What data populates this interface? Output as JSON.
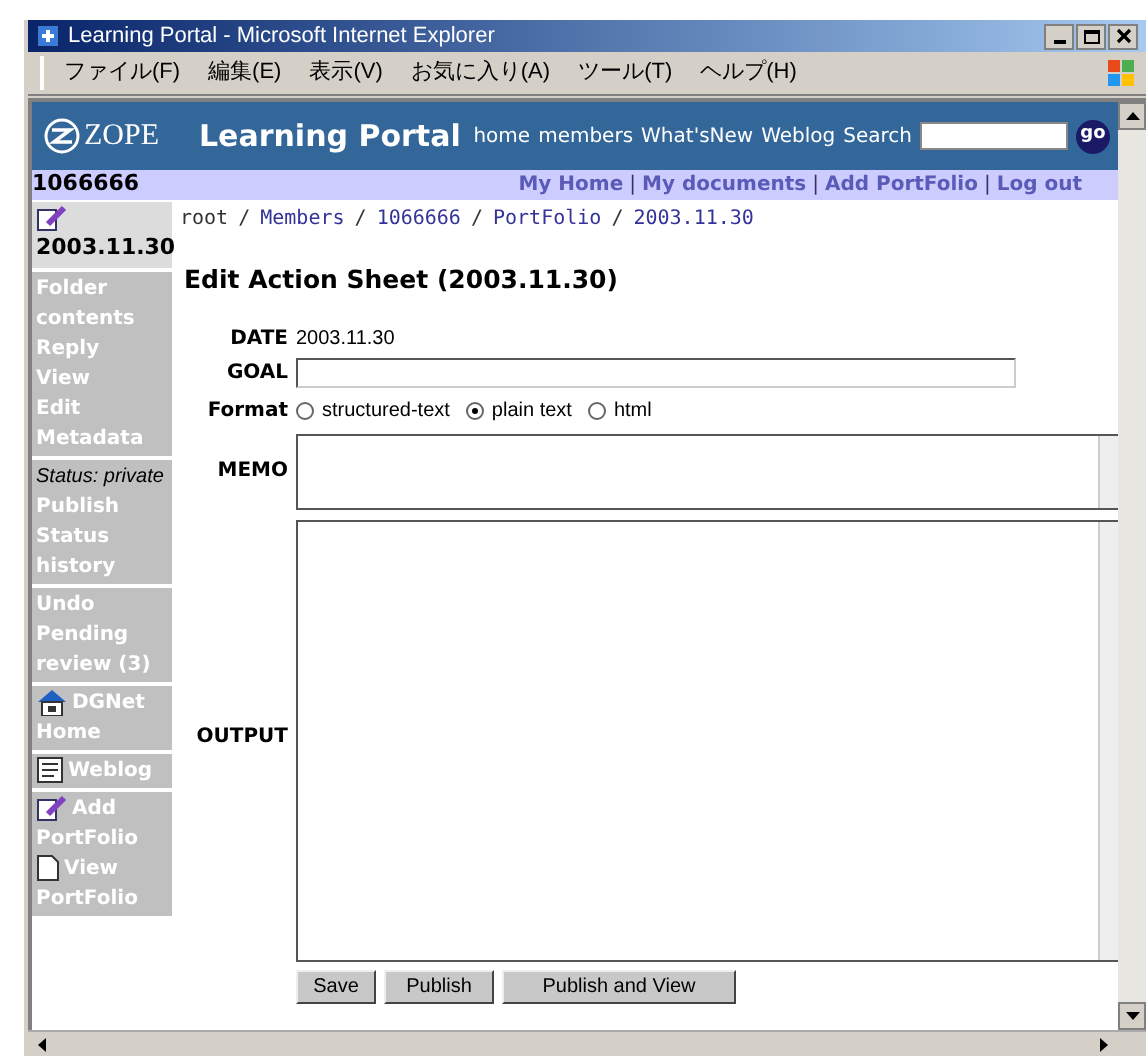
{
  "window": {
    "title": "Learning Portal - Microsoft Internet Explorer"
  },
  "menu": [
    "ファイル(F)",
    "編集(E)",
    "表示(V)",
    "お気に入り(A)",
    "ツール(T)",
    "ヘルプ(H)"
  ],
  "header": {
    "logo": "ZOPE",
    "site_title": "Learning Portal",
    "nav": [
      "home",
      "members",
      "What'sNew",
      "Weblog",
      "Search"
    ],
    "search_button": "go"
  },
  "user_bar": {
    "user_id": "1066666",
    "links": [
      {
        "label": "My Home",
        "separator": "|"
      },
      {
        "label": "My documents",
        "separator": "|"
      },
      {
        "label": "Add PortFolio",
        "separator": "|"
      },
      {
        "label": "Log out"
      }
    ]
  },
  "sidebar": [
    {
      "items": [
        {
          "kind": "heading",
          "text": "2003.11.30"
        }
      ]
    },
    {
      "items": [
        {
          "kind": "link",
          "text": "Folder contents"
        },
        {
          "kind": "link",
          "text": "Reply"
        },
        {
          "kind": "link",
          "text": "View"
        },
        {
          "kind": "link",
          "text": "Edit Metadata"
        }
      ]
    },
    {
      "items": [
        {
          "kind": "status",
          "text": "Status: private"
        },
        {
          "kind": "link",
          "text": "Publish"
        },
        {
          "kind": "link",
          "text": "Status history"
        }
      ]
    },
    {
      "items": [
        {
          "kind": "link",
          "text": "Undo"
        },
        {
          "kind": "link",
          "text": "Pending review (3)"
        }
      ]
    },
    {
      "items": [
        {
          "kind": "icon_link",
          "text": "DGNet Home"
        }
      ]
    },
    {
      "items": [
        {
          "kind": "icon_link",
          "text": "Weblog"
        }
      ]
    },
    {
      "items": [
        {
          "kind": "icon_link",
          "text": "Add PortFolio"
        },
        {
          "kind": "icon_link",
          "text": "View PortFolio"
        }
      ]
    }
  ],
  "breadcrumbs": [
    {
      "label": "root",
      "separator": "/"
    },
    {
      "label": "Members",
      "separator": "/"
    },
    {
      "label": "1066666",
      "separator": "/"
    },
    {
      "label": "PortFolio",
      "separator": "/"
    },
    {
      "label": "2003.11.30"
    }
  ],
  "form": {
    "title": "Edit Action Sheet (2003.11.30)",
    "date_label": "DATE",
    "date": "2003.11.30",
    "goal_label": "GOAL",
    "format_label": "Format",
    "formats": [
      {
        "label": "structured-text",
        "selected": false
      },
      {
        "label": "plain text",
        "selected": true
      },
      {
        "label": "html",
        "selected": false
      }
    ],
    "memo_label": "MEMO",
    "output_label": "OUTPUT",
    "buttons": [
      "Save",
      "Publish",
      "Publish and View"
    ]
  }
}
